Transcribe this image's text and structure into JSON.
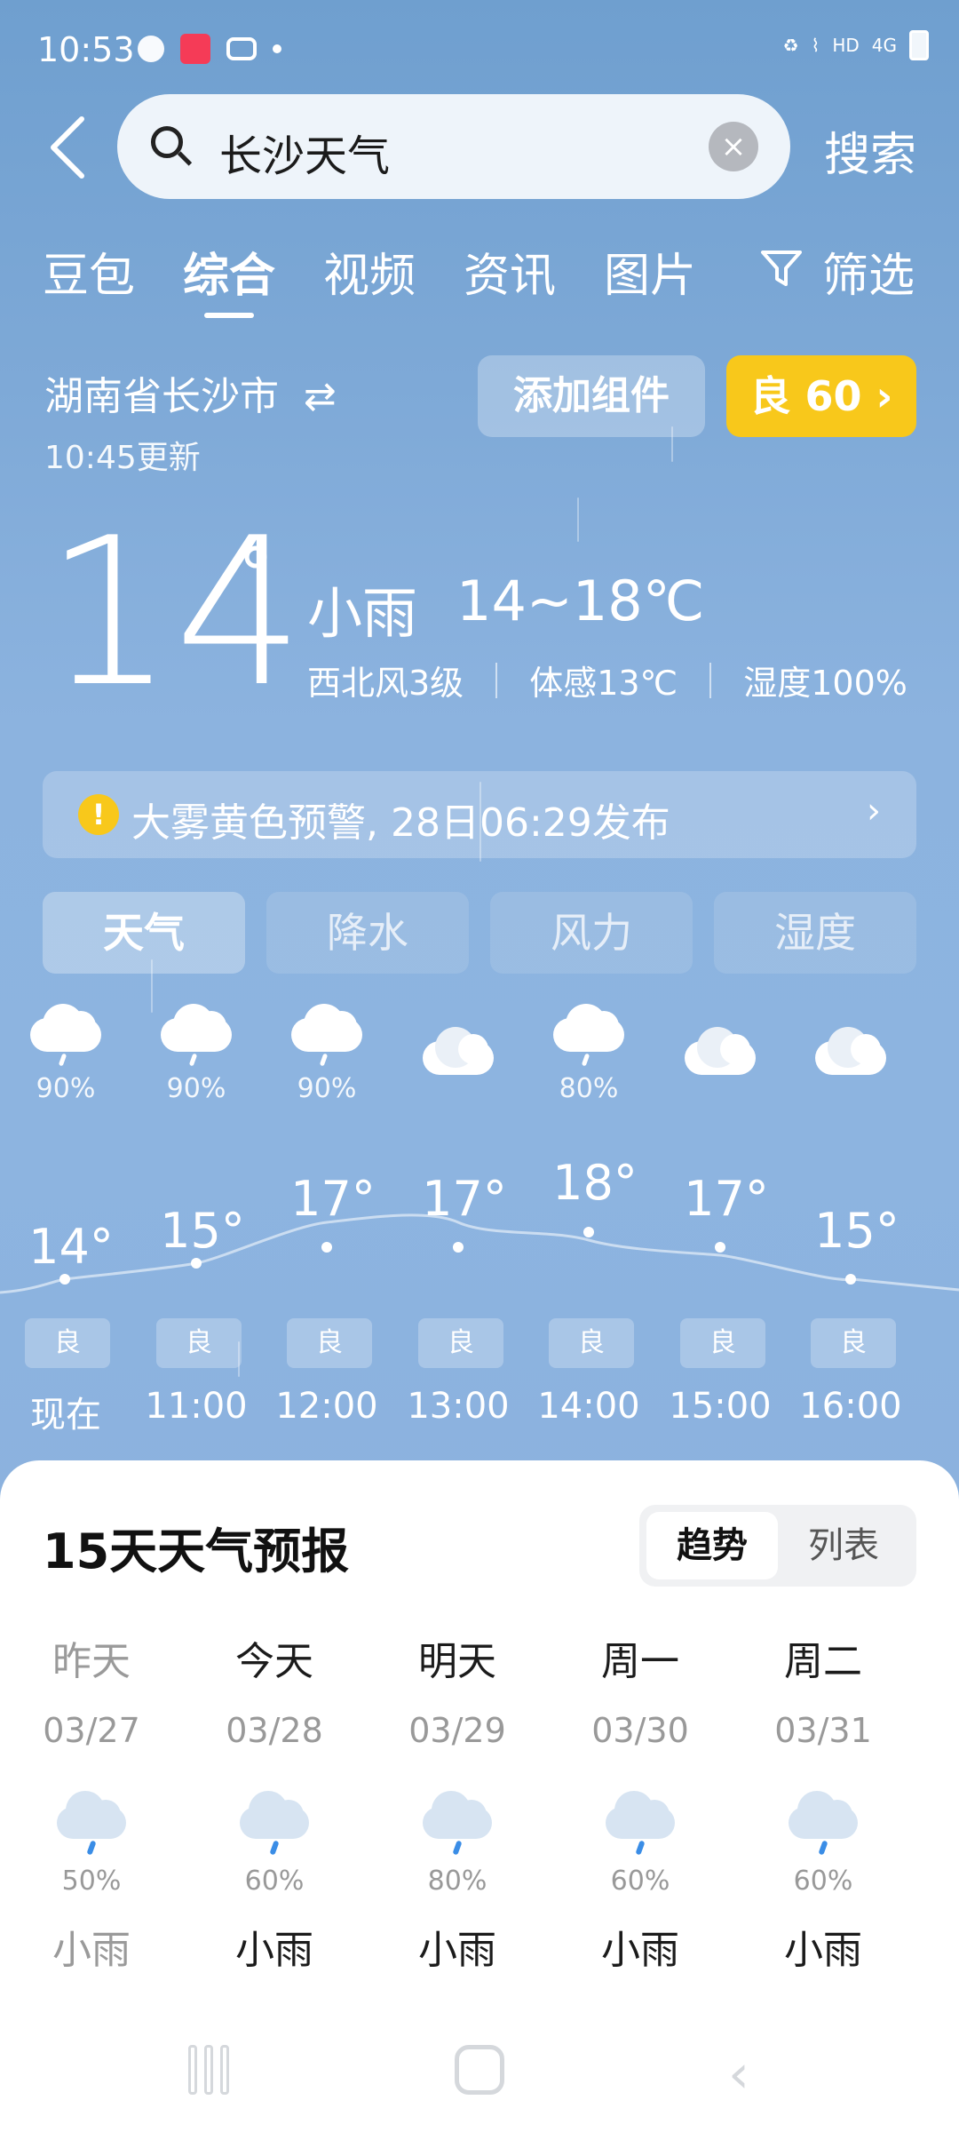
{
  "status_bar": {
    "time": "10:53",
    "network": "HD",
    "signal": "4G"
  },
  "search": {
    "query": "长沙天气",
    "button": "搜索",
    "clear_icon": "×"
  },
  "tabs": [
    {
      "label": "豆包"
    },
    {
      "label": "综合"
    },
    {
      "label": "视频"
    },
    {
      "label": "资讯"
    },
    {
      "label": "图片"
    },
    {
      "label": "筛选"
    }
  ],
  "location": {
    "name": "湖南省长沙市",
    "updated": "10:45更新"
  },
  "buttons": {
    "add_widget": "添加组件",
    "aqi": "良 60 ›"
  },
  "current": {
    "temp": "14",
    "deg": "°",
    "condition": "小雨",
    "range": "14~18℃",
    "wind": "西北风3级",
    "feels": "体感13℃",
    "humidity": "湿度100%"
  },
  "alert": {
    "text": "大雾黄色预警, 28日06:29发布",
    "chevron": "›",
    "icon": "!"
  },
  "subtabs": [
    {
      "label": "天气"
    },
    {
      "label": "降水"
    },
    {
      "label": "风力"
    },
    {
      "label": "湿度"
    }
  ],
  "hourly": [
    {
      "time": "现在",
      "temp": "14°",
      "pct": "90%",
      "aqi": "良"
    },
    {
      "time": "11:00",
      "temp": "15°",
      "pct": "90%",
      "aqi": "良"
    },
    {
      "time": "12:00",
      "temp": "17°",
      "pct": "90%",
      "aqi": "良"
    },
    {
      "time": "13:00",
      "temp": "17°",
      "pct": "",
      "aqi": "良"
    },
    {
      "time": "14:00",
      "temp": "18°",
      "pct": "80%",
      "aqi": "良"
    },
    {
      "time": "15:00",
      "temp": "17°",
      "pct": "",
      "aqi": "良"
    },
    {
      "time": "16:00",
      "temp": "15°",
      "pct": "",
      "aqi": "良"
    }
  ],
  "forecast": {
    "title": "15天天气预报",
    "segment": {
      "trend": "趋势",
      "list": "列表"
    },
    "days": [
      {
        "day": "昨天",
        "date": "03/27",
        "pct": "50%",
        "weather": "小雨"
      },
      {
        "day": "今天",
        "date": "03/28",
        "pct": "60%",
        "weather": "小雨"
      },
      {
        "day": "明天",
        "date": "03/29",
        "pct": "80%",
        "weather": "小雨"
      },
      {
        "day": "周一",
        "date": "03/30",
        "pct": "60%",
        "weather": "小雨"
      },
      {
        "day": "周二",
        "date": "03/31",
        "pct": "60%",
        "weather": "小雨"
      }
    ]
  },
  "colors": {
    "aqi_badge": "#f8c81b",
    "alert_icon": "#f8c81b",
    "rain_drop": "#3a8de6"
  }
}
